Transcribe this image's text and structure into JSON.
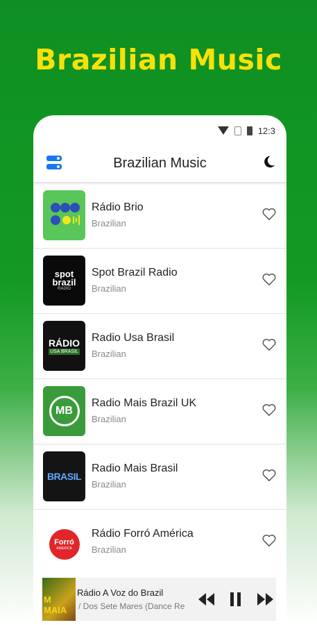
{
  "banner": {
    "headline": "Brazilian Music"
  },
  "status_bar": {
    "time": "12:3"
  },
  "app_bar": {
    "title": "Brazilian Music",
    "menu_icon": "toggle-menu-icon",
    "theme_icon": "moon-icon"
  },
  "stations": [
    {
      "name": "Rádio Brio",
      "genre": "Brazilian",
      "favorite": false
    },
    {
      "name": "Spot Brazil Radio",
      "genre": "Brazilian",
      "favorite": false,
      "logo_text": [
        "spot",
        "brazil",
        "RADIO"
      ]
    },
    {
      "name": "Radio Usa Brasil",
      "genre": "Brazilian",
      "favorite": false,
      "logo_text": [
        "RÁDIO",
        "USA BRASIL"
      ]
    },
    {
      "name": "Radio Mais Brazil UK",
      "genre": "Brazilian",
      "favorite": false,
      "logo_text": [
        "MB"
      ]
    },
    {
      "name": "Radio Mais Brasil",
      "genre": "Brazilian",
      "favorite": false,
      "logo_text": [
        "BRASIL"
      ]
    },
    {
      "name": "Rádio Forró América",
      "genre": "Brazilian",
      "favorite": false,
      "logo_text": [
        "Forró",
        "AMERICA"
      ]
    }
  ],
  "now_playing": {
    "station": "Rádio A Voz do Brazil",
    "track": "/ Dos Sete Mares (Dance Re",
    "art_text": "M MAIA"
  },
  "colors": {
    "background_green": "#129a24",
    "headline_yellow": "#f7e10b",
    "accent_blue": "#1976f2"
  }
}
